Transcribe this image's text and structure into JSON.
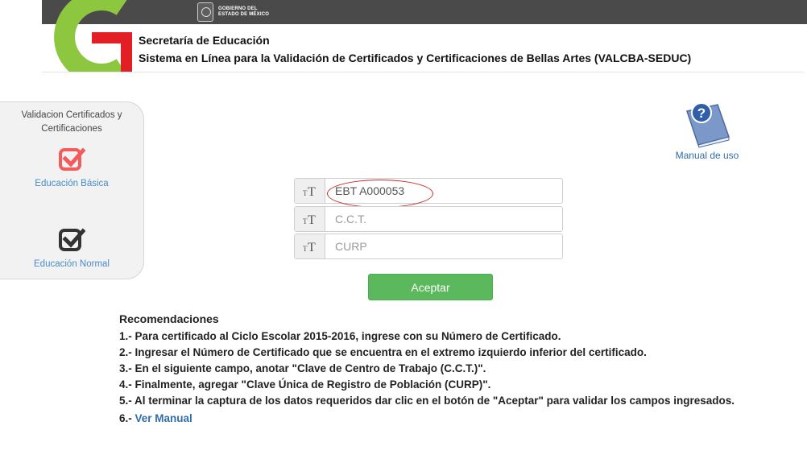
{
  "header": {
    "gov_logo_line1": "GOBIERNO DEL",
    "gov_logo_line2": "ESTADO DE MÉXICO",
    "title": "Secretaría de Educación",
    "subtitle": "Sistema en Línea para la Validación de Certificados y Certificaciones de Bellas Artes (VALCBA-SEDUC)"
  },
  "sidebar": {
    "title": "Validacion Certificados y Certificaciones",
    "items": [
      {
        "label": "Educación Básica",
        "icon": "checkbox-icon",
        "color": "#f25c5c"
      },
      {
        "label": "Educación Normal",
        "icon": "checkbox-icon",
        "color": "#333333"
      }
    ]
  },
  "manual": {
    "label": "Manual de uso",
    "icon": "book-help-icon"
  },
  "form": {
    "certificate": {
      "value": "EBT A000053",
      "placeholder": ""
    },
    "cct": {
      "value": "",
      "placeholder": "C.C.T."
    },
    "curp": {
      "value": "",
      "placeholder": "CURP"
    },
    "submit_label": "Aceptar"
  },
  "recommendations": {
    "title": "Recomendaciones",
    "items": [
      "1.- Para certificado al Ciclo Escolar 2015-2016, ingrese con su Número de Certificado.",
      "2.- Ingresar el Número de Certificado que se encuentra en el extremo izquierdo inferior del certificado.",
      "3.- En el siguiente campo, anotar \"Clave de Centro de Trabajo (C.C.T.)\".",
      "4.- Finalmente, agregar \"Clave Única de Registro de Población (CURP)\".",
      "5.- Al terminar la captura de los datos requeridos dar clic en el botón de \"Aceptar\" para validar los campos ingresados."
    ],
    "item6_prefix": "6.-",
    "item6_link": "Ver Manual"
  },
  "colors": {
    "accent_green": "#5cb85c",
    "brand_green": "#8dc63f",
    "brand_red": "#e31e24",
    "link_blue": "#2f6ea8"
  }
}
